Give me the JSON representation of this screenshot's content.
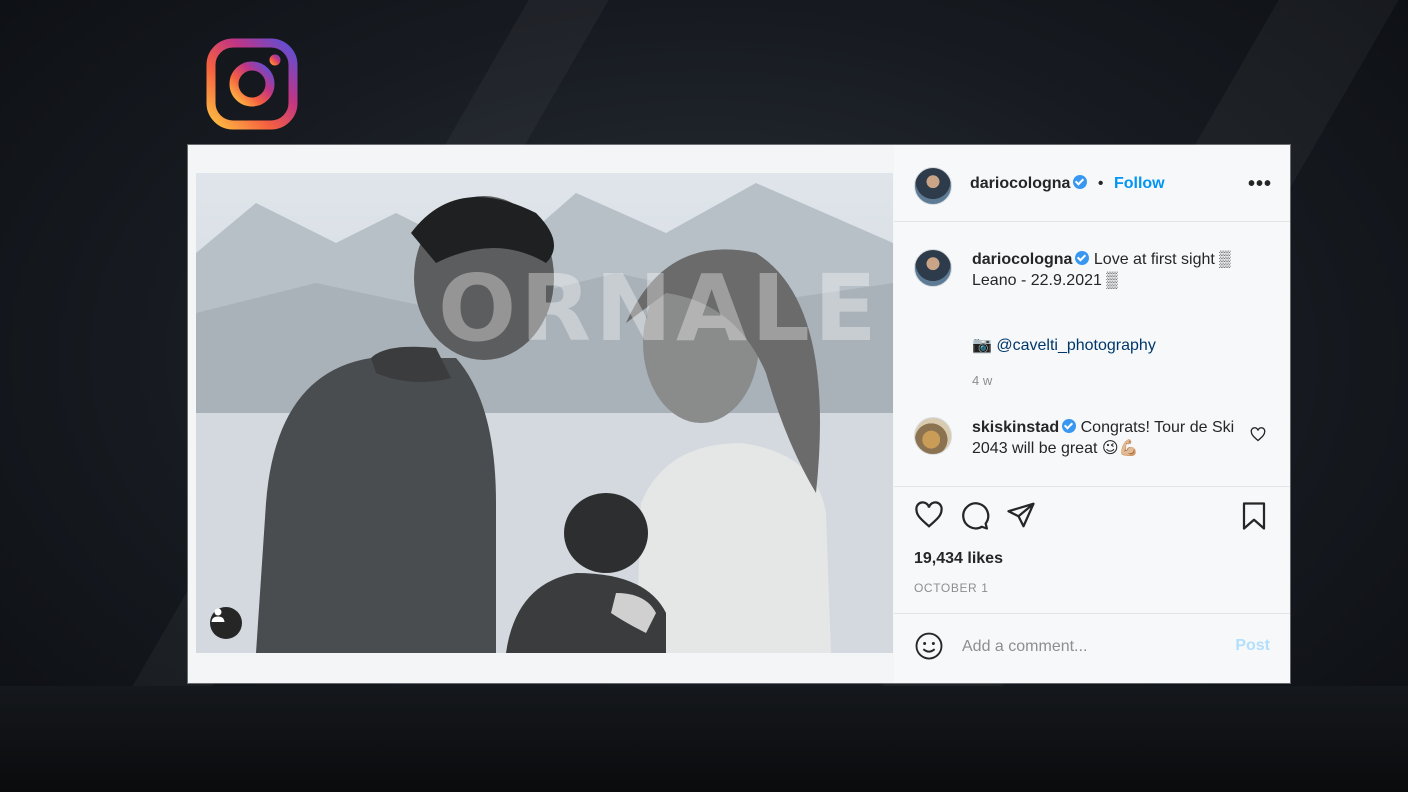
{
  "colors": {
    "accent": "#0095f6",
    "verified": "#3897f0",
    "text": "#262626",
    "muted": "#8e8e8e",
    "post_disabled": "#b2dffc"
  },
  "logo": {
    "icon": "instagram-logo-icon"
  },
  "photo": {
    "watermark": "ORNALE",
    "tag_icon": "user-icon"
  },
  "header": {
    "username": "dariocologna",
    "separator": "•",
    "follow_label": "Follow",
    "more_label": "•••"
  },
  "caption": {
    "username": "dariocologna",
    "text": "Love at first sight ▒ Leano - 22.9.2021 ▒",
    "mention": "📷 @cavelti_photography",
    "time": "4 w"
  },
  "comment": {
    "username": "skiskinstad",
    "text": "Congrats! Tour de Ski 2043 will be great 😉💪🏼"
  },
  "actions": {
    "like_icon": "heart-icon",
    "comment_icon": "comment-icon",
    "share_icon": "paper-plane-icon",
    "save_icon": "bookmark-icon"
  },
  "likes": "19,434 likes",
  "date": "OCTOBER 1",
  "add_comment": {
    "placeholder": "Add a comment...",
    "post_label": "Post",
    "emoji_icon": "smiley-icon"
  }
}
